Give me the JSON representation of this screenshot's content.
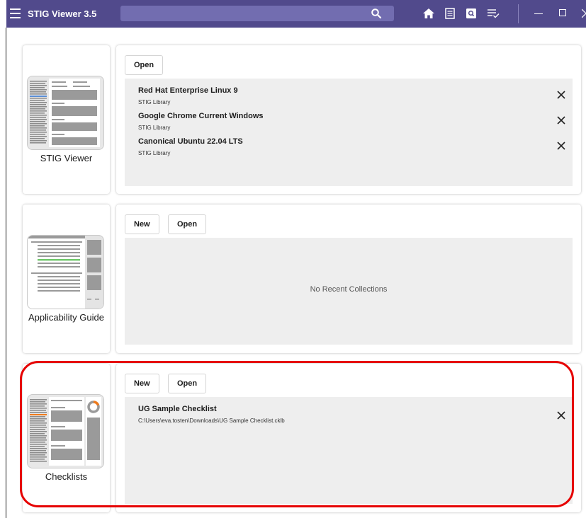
{
  "app": {
    "title": "STIG Viewer 3.5"
  },
  "icons": {
    "menu": "menu-icon",
    "search": "search-icon",
    "home": "home-icon",
    "library": "library-icon",
    "find": "find-icon",
    "checklist": "checklist-icon",
    "minimize": "minimize-icon",
    "maximize": "maximize-icon",
    "close": "close-icon"
  },
  "colors": {
    "titlebar": "#514a8c",
    "search": "#726db0",
    "highlight": "#e60000"
  },
  "stig_viewer": {
    "label": "STIG Viewer",
    "open_label": "Open",
    "items": [
      {
        "title": "Red Hat Enterprise Linux 9",
        "subtitle": "STIG Library"
      },
      {
        "title": "Google Chrome Current Windows",
        "subtitle": "STIG Library"
      },
      {
        "title": "Canonical Ubuntu 22.04 LTS",
        "subtitle": "STIG Library"
      }
    ]
  },
  "applicability": {
    "label": "Applicability Guide",
    "new_label": "New",
    "open_label": "Open",
    "empty_message": "No Recent Collections"
  },
  "checklists": {
    "label": "Checklists",
    "new_label": "New",
    "open_label": "Open",
    "items": [
      {
        "title": "UG Sample Checklist",
        "subtitle": "C:\\Users\\eva.tosten\\Downloads\\UG Sample Checklist.cklb"
      }
    ]
  }
}
